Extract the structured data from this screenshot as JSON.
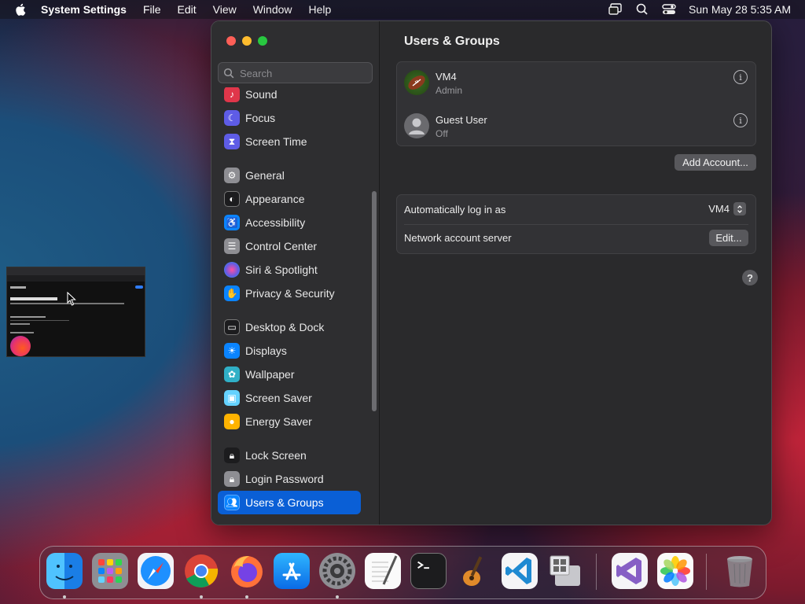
{
  "menubar": {
    "app_name": "System Settings",
    "menus": [
      "File",
      "Edit",
      "View",
      "Window",
      "Help"
    ],
    "datetime": "Sun May 28  5:35 AM"
  },
  "search": {
    "placeholder": "Search"
  },
  "sidebar": {
    "items": [
      {
        "label": "Sound",
        "icon": "sound-icon",
        "color": "#e0364a"
      },
      {
        "label": "Focus",
        "icon": "moon-icon",
        "color": "#5e5ce6"
      },
      {
        "label": "Screen Time",
        "icon": "hourglass-icon",
        "color": "#5e5ce6"
      },
      {
        "label": "General",
        "icon": "gear-icon",
        "color": "#8e8e93"
      },
      {
        "label": "Appearance",
        "icon": "appearance-icon",
        "color": "#1c1c1e"
      },
      {
        "label": "Accessibility",
        "icon": "accessibility-icon",
        "color": "#0a84ff"
      },
      {
        "label": "Control Center",
        "icon": "control-center-icon",
        "color": "#8e8e93"
      },
      {
        "label": "Siri & Spotlight",
        "icon": "siri-icon",
        "color": "#bf5af2"
      },
      {
        "label": "Privacy & Security",
        "icon": "hand-icon",
        "color": "#0a84ff"
      },
      {
        "label": "Desktop & Dock",
        "icon": "dock-icon",
        "color": "#1c1c1e"
      },
      {
        "label": "Displays",
        "icon": "sun-icon",
        "color": "#0a84ff"
      },
      {
        "label": "Wallpaper",
        "icon": "wallpaper-icon",
        "color": "#30b0c7"
      },
      {
        "label": "Screen Saver",
        "icon": "screen-saver-icon",
        "color": "#64d2ff"
      },
      {
        "label": "Energy Saver",
        "icon": "bulb-icon",
        "color": "#ffb300"
      },
      {
        "label": "Lock Screen",
        "icon": "lock-icon",
        "color": "#1c1c1e"
      },
      {
        "label": "Login Password",
        "icon": "login-lock-icon",
        "color": "#8e8e93"
      },
      {
        "label": "Users & Groups",
        "icon": "users-icon",
        "color": "#0a84ff"
      }
    ],
    "selected": "Users & Groups"
  },
  "content": {
    "title": "Users & Groups",
    "users": [
      {
        "name": "VM4",
        "role": "Admin",
        "avatar": "football-avatar"
      },
      {
        "name": "Guest User",
        "role": "Off",
        "avatar": "person-avatar"
      }
    ],
    "add_account_label": "Add Account...",
    "auto_login_label": "Automatically log in as",
    "auto_login_value": "VM4",
    "network_server_label": "Network account server",
    "edit_label": "Edit...",
    "help_label": "?"
  },
  "dock": {
    "apps": [
      "Finder",
      "Launchpad",
      "Safari",
      "Google Chrome",
      "Firefox",
      "App Store",
      "System Settings",
      "TextEdit",
      "Terminal",
      "GarageBand",
      "Visual Studio Code",
      "Boot Camp Assistant",
      "Visual Studio",
      "Photos",
      "Trash"
    ]
  }
}
